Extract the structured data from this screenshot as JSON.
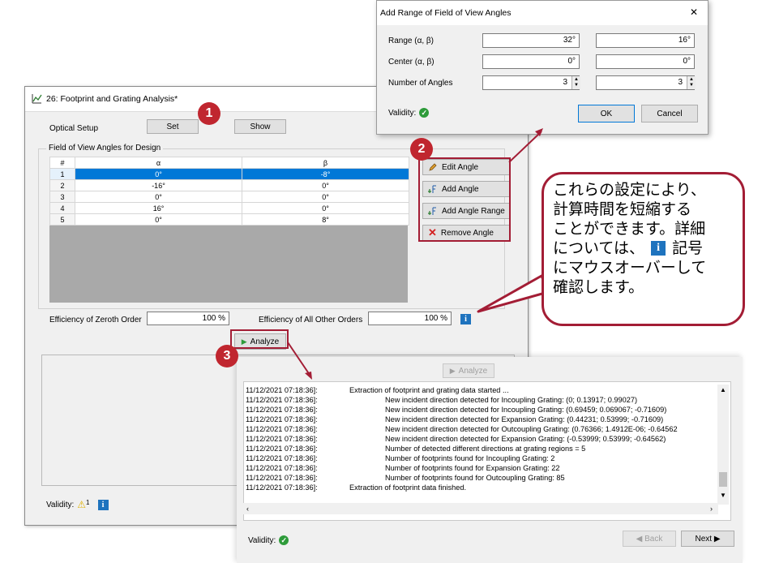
{
  "main_window": {
    "title": "26: Footprint and Grating Analysis*",
    "optical_setup_label": "Optical Setup",
    "set_label": "Set",
    "show_label": "Show",
    "group_label": "Field of View Angles for Design",
    "table": {
      "headers": [
        "#",
        "α",
        "β"
      ],
      "rows": [
        {
          "n": "1",
          "a": "0°",
          "b": "-8°"
        },
        {
          "n": "2",
          "a": "-16°",
          "b": "0°"
        },
        {
          "n": "3",
          "a": "0°",
          "b": "0°"
        },
        {
          "n": "4",
          "a": "16°",
          "b": "0°"
        },
        {
          "n": "5",
          "a": "0°",
          "b": "8°"
        }
      ]
    },
    "edit_angle": "Edit Angle",
    "add_angle": "Add Angle",
    "add_angle_range": "Add Angle Range",
    "remove_angle": "Remove Angle",
    "eff_zeroth_label": "Efficiency of Zeroth Order",
    "eff_zeroth_value": "100 %",
    "eff_other_label": "Efficiency of All Other Orders",
    "eff_other_value": "100 %",
    "analyze_label": "Analyze",
    "validity_label": "Validity:",
    "warning_count": "1"
  },
  "log_window": {
    "analyze_label": "Analyze",
    "timestamp": "11/12/2021 07:18:36]:",
    "entries": [
      {
        "indent": false,
        "msg": "Extraction of footprint and grating data started ..."
      },
      {
        "indent": true,
        "msg": "New incident direction detected for Incoupling Grating: (0; 0.13917; 0.99027)"
      },
      {
        "indent": true,
        "msg": "New incident direction detected for Incoupling Grating: (0.69459; 0.069067; -0.71609)"
      },
      {
        "indent": true,
        "msg": "New incident direction detected for Expansion Grating: (0.44231; 0.53999; -0.71609)"
      },
      {
        "indent": true,
        "msg": "New incident direction detected for Outcoupling Grating: (0.76366; 1.4912E-06; -0.64562"
      },
      {
        "indent": true,
        "msg": "New incident direction detected for Expansion Grating: (-0.53999; 0.53999; -0.64562)"
      },
      {
        "indent": true,
        "msg": "Number of detected different directions at grating regions = 5"
      },
      {
        "indent": true,
        "msg": "Number of footprints found for Incoupling Grating: 2"
      },
      {
        "indent": true,
        "msg": "Number of footprints found for Expansion Grating: 22"
      },
      {
        "indent": true,
        "msg": "Number of footprints found for Outcoupling Grating: 85"
      },
      {
        "indent": false,
        "msg": "Extraction of footprint data finished."
      }
    ],
    "validity_label": "Validity:",
    "back_label": "◀ Back",
    "next_label": "Next ▶"
  },
  "dialog": {
    "title": "Add Range of Field of View Angles",
    "close": "✕",
    "range_label": "Range (α, β)",
    "range_a": "32°",
    "range_b": "16°",
    "center_label": "Center (α, β)",
    "center_a": "0°",
    "center_b": "0°",
    "num_label": "Number of Angles",
    "num_a": "3",
    "num_b": "3",
    "validity_label": "Validity:",
    "ok_label": "OK",
    "cancel_label": "Cancel"
  },
  "callout": {
    "line1": "これらの設定により、",
    "line2": "計算時間を短縮する",
    "line3": "ことができます。詳細",
    "line4a": "については、",
    "info_glyph": "i",
    "line4b": "記号",
    "line5": "にマウスオーバーして",
    "line6": "確認します。"
  },
  "badges": [
    "1",
    "2",
    "3"
  ],
  "colors": {
    "accent_red": "#a31d35",
    "badge_red": "#c0262f",
    "selection_blue": "#0078d7",
    "info_blue": "#1e73be",
    "valid_green": "#2e9b3a"
  }
}
